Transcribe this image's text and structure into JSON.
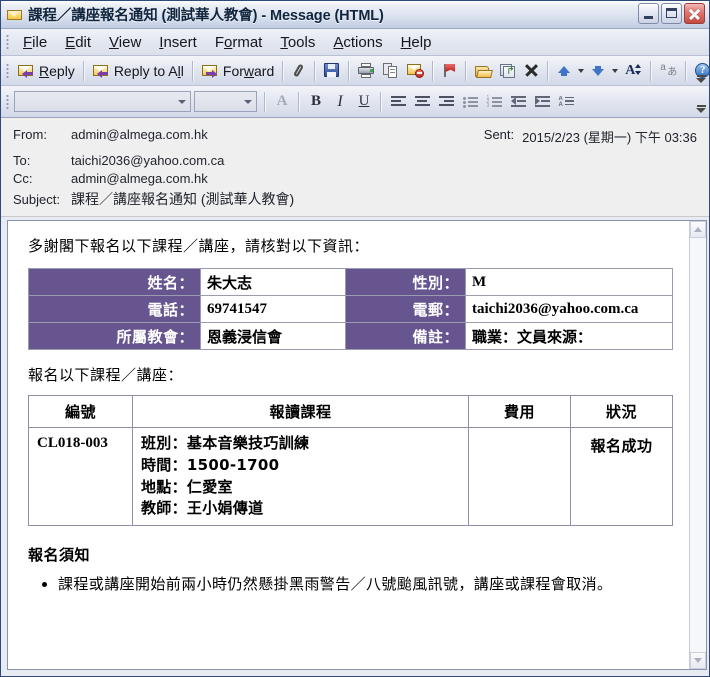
{
  "window": {
    "title": "課程／講座報名通知 (測試華人教會) - Message (HTML)",
    "icon": "envelope-icon",
    "buttons": {
      "minimize": "Minimize",
      "maximize": "Maximize",
      "close": "Close"
    }
  },
  "menubar": {
    "items": [
      {
        "label": "File",
        "accel": "F",
        "rest": "ile"
      },
      {
        "label": "Edit",
        "accel": "E",
        "rest": "dit"
      },
      {
        "label": "View",
        "accel": "V",
        "rest": "iew"
      },
      {
        "label": "Insert",
        "accel": "I",
        "rest": "nsert"
      },
      {
        "label": "Format",
        "accel": "o",
        "rest": ""
      },
      {
        "label": "Tools",
        "accel": "T",
        "rest": "ools"
      },
      {
        "label": "Actions",
        "accel": "A",
        "rest": "ctions"
      },
      {
        "label": "Help",
        "accel": "H",
        "rest": "elp"
      }
    ]
  },
  "toolbar": {
    "reply": "Reply",
    "reply_all": "Reply to All",
    "forward": "Forward",
    "icons": [
      "paperclip-icon",
      "save-icon",
      "print-icon",
      "copy-icon",
      "delete-mail-icon",
      "flag-icon",
      "open-folder-icon",
      "move-to-folder-icon",
      "delete-icon",
      "previous-item-icon",
      "next-item-icon",
      "font-size-icon",
      "translate-icon",
      "help-icon"
    ]
  },
  "format_toolbar": {
    "font_name": "",
    "font_size": "",
    "buttons": [
      "font-color-icon",
      "bold-icon",
      "italic-icon",
      "underline-icon",
      "align-left-icon",
      "align-center-icon",
      "align-right-icon",
      "bullets-icon",
      "numbering-icon",
      "decrease-indent-icon",
      "increase-indent-icon",
      "line-spacing-icon"
    ],
    "bold": "B",
    "italic": "I",
    "underline": "U",
    "font_color": "A"
  },
  "header": {
    "from_label": "From:",
    "from_value": "admin@almega.com.hk",
    "to_label": "To:",
    "to_value": "taichi2036@yahoo.com.ca",
    "cc_label": "Cc:",
    "cc_value": "admin@almega.com.hk",
    "subject_label": "Subject:",
    "subject_value": "課程／講座報名通知 (測試華人教會)",
    "sent_label": "Sent:",
    "sent_value": "2015/2/23 (星期一) 下午 03:36"
  },
  "body": {
    "intro": "多謝閣下報名以下課程／講座，請核對以下資訊：",
    "info_table": {
      "rows": [
        {
          "left_label": "姓名：",
          "left_value": "朱大志",
          "right_label": "性別：",
          "right_value": "M"
        },
        {
          "left_label": "電話：",
          "left_value": "69741547",
          "right_label": "電郵：",
          "right_value": "taichi2036@yahoo.com.ca"
        },
        {
          "left_label": "所屬教會：",
          "left_value": "恩義浸信會",
          "right_label": "備註：",
          "right_value": "職業：文員來源："
        }
      ]
    },
    "courses_intro": "報名以下課程／講座：",
    "courses_table": {
      "headers": [
        "編號",
        "報讀課程",
        "費用",
        "狀況"
      ],
      "rows": [
        {
          "code": "CL018-003",
          "detail_lines": [
            "班別：基本音樂技巧訓練",
            "時間：1500-1700",
            "地點：仁愛室",
            "教師：王小娟傳道"
          ],
          "fee": "",
          "status": "報名成功"
        }
      ]
    },
    "notice_title": "報名須知",
    "notice_items": [
      "課程或講座開始前兩小時仍然懸掛黑雨警告／八號颱風訊號，講座或課程會取消。"
    ]
  },
  "colors": {
    "table_header_purple": "#66558f",
    "titlebar_text": "#10243e",
    "header_panel": "#efefef"
  }
}
